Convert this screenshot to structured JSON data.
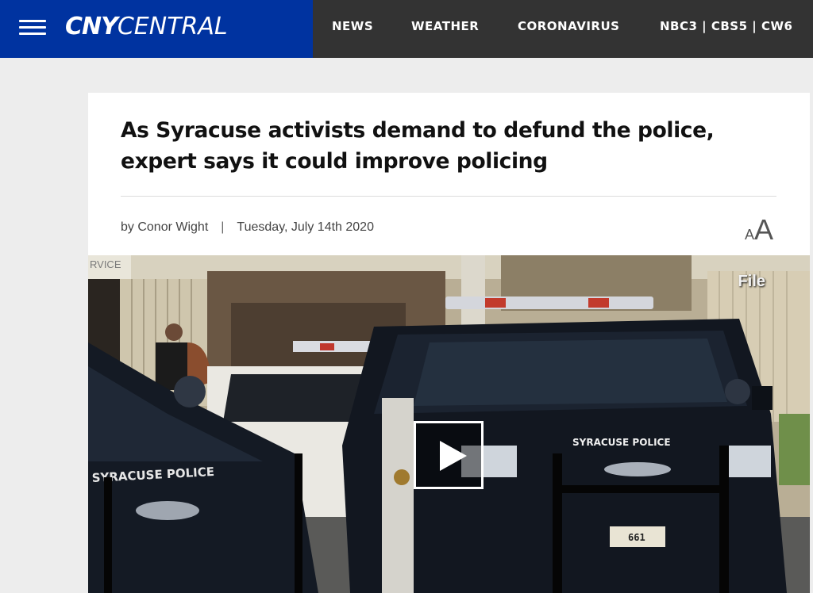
{
  "header": {
    "logo_bold": "CNY",
    "logo_light": "CENTRAL",
    "nav": [
      {
        "label": "NEWS"
      },
      {
        "label": "WEATHER"
      },
      {
        "label": "CORONAVIRUS"
      },
      {
        "label": "NBC3 | CBS5 | CW6"
      }
    ],
    "colors": {
      "brand_blue": "#0033a0",
      "nav_bg": "#333333"
    }
  },
  "article": {
    "headline": "As Syracuse activists demand to defund the police, expert says it could improve policing",
    "author": "by Conor Wight",
    "separator": "|",
    "date": "Tuesday, July 14th 2020",
    "font_toggle_small": "A",
    "font_toggle_big": "A"
  },
  "video": {
    "tag": "File",
    "scene_labels": {
      "car_right": "SYRACUSE POLICE",
      "car_left": "SYRACUSE POLICE",
      "plate": "661",
      "sign": "RVICE"
    }
  }
}
